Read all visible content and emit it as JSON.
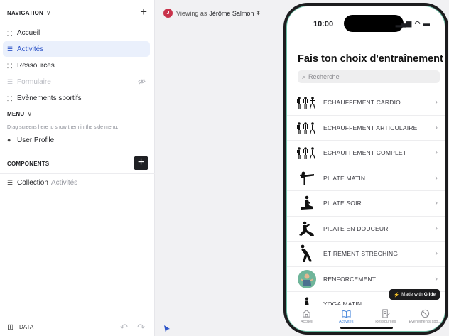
{
  "sidebar": {
    "navigation": {
      "title": "NAVIGATION",
      "items": [
        {
          "label": "Accueil",
          "state": "normal"
        },
        {
          "label": "Activités",
          "state": "active"
        },
        {
          "label": "Ressources",
          "state": "normal"
        },
        {
          "label": "Formulaire",
          "state": "hidden"
        },
        {
          "label": "Evènements sportifs",
          "state": "normal"
        }
      ]
    },
    "menu": {
      "title": "MENU",
      "hint": "Drag screens here to show them in the side menu.",
      "items": [
        {
          "label": "User Profile"
        }
      ]
    },
    "components": {
      "title": "COMPONENTS",
      "collection_label": "Collection",
      "collection_source": "Activités"
    },
    "footer": {
      "data_label": "DATA"
    }
  },
  "viewer": {
    "prefix": "Viewing as",
    "name": "Jérôme Salmon",
    "avatar_initial": "J"
  },
  "phone": {
    "time": "10:00",
    "title": "Fais ton choix d'entraînement",
    "search_placeholder": "Recherche",
    "items": [
      {
        "label": "ECHAUFFEMENT CARDIO",
        "icon": "group-figures-icon"
      },
      {
        "label": "ECHAUFFEMENT ARTICULAIRE",
        "icon": "group-figures-icon"
      },
      {
        "label": "ECHAUFFEMENT COMPLET",
        "icon": "group-figures-icon"
      },
      {
        "label": "PILATE MATIN",
        "icon": "balance-pose-icon"
      },
      {
        "label": "PILATE SOIR",
        "icon": "seated-stretch-icon"
      },
      {
        "label": "PILATE EN DOUCEUR",
        "icon": "lunge-pose-icon"
      },
      {
        "label": "ETIREMENT STRECHING",
        "icon": "forward-bend-icon"
      },
      {
        "label": "RENFORCEMENT",
        "icon": "avatar-photo-icon"
      },
      {
        "label": "YOGA MATIN",
        "icon": "seated-stretch-icon"
      }
    ],
    "badge": {
      "prefix": "Made with",
      "brand": "Glide"
    },
    "tabs": [
      {
        "label": "Accueil",
        "active": false
      },
      {
        "label": "Activités",
        "active": true
      },
      {
        "label": "Ressources",
        "active": false
      },
      {
        "label": "Evènements spo...",
        "active": false
      }
    ]
  },
  "colors": {
    "accent": "#2f55c8",
    "tab_active": "#4a89dc",
    "avatar": "#c8324a"
  }
}
